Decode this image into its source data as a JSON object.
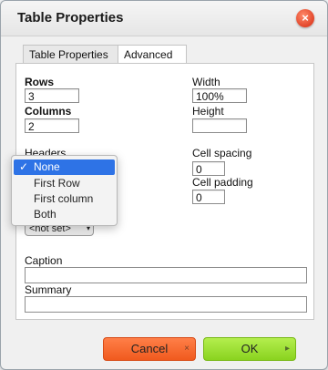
{
  "window": {
    "title": "Table Properties"
  },
  "tabs": [
    {
      "label": "Table Properties"
    },
    {
      "label": "Advanced"
    }
  ],
  "fields": {
    "rows": {
      "label": "Rows",
      "value": "3"
    },
    "columns": {
      "label": "Columns",
      "value": "2"
    },
    "width": {
      "label": "Width",
      "value": "100%"
    },
    "height": {
      "label": "Height",
      "value": ""
    },
    "headers": {
      "label": "Headers"
    },
    "cell_spacing": {
      "label": "Cell spacing",
      "value": "0"
    },
    "cell_padding": {
      "label": "Cell padding",
      "value": "0"
    },
    "alignment_select": {
      "value": "<not set>"
    },
    "caption": {
      "label": "Caption",
      "value": ""
    },
    "summary": {
      "label": "Summary",
      "value": ""
    }
  },
  "headers_dropdown": {
    "options": [
      "None",
      "First Row",
      "First column",
      "Both"
    ],
    "selected": "None"
  },
  "buttons": {
    "cancel": "Cancel",
    "ok": "OK"
  },
  "background": {
    "peek_letter": "e"
  },
  "colors": {
    "selection": "#2e73e6",
    "cancel": "#f05a1e",
    "ok": "#8ad31f",
    "close": "#e2452a"
  }
}
